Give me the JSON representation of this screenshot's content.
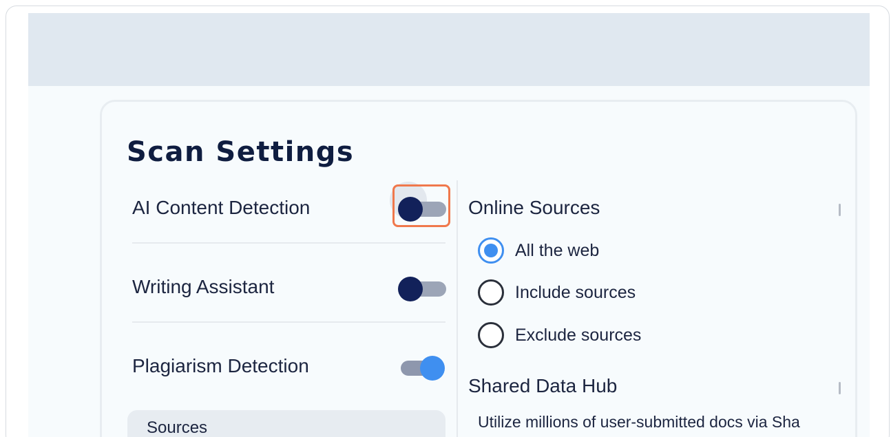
{
  "panel": {
    "title": "Scan Settings"
  },
  "toggles": [
    {
      "label": "AI Content Detection",
      "state": "off",
      "highlighted": true
    },
    {
      "label": "Writing Assistant",
      "state": "off",
      "highlighted": false
    },
    {
      "label": "Plagiarism Detection",
      "state": "on",
      "highlighted": false
    }
  ],
  "sources_box": {
    "label": "Sources"
  },
  "online_sources": {
    "title": "Online Sources",
    "options": [
      {
        "label": "All the web",
        "selected": true
      },
      {
        "label": "Include sources",
        "selected": false
      },
      {
        "label": "Exclude sources",
        "selected": false
      }
    ]
  },
  "shared_data_hub": {
    "title": "Shared Data Hub",
    "description": "Utilize millions of user-submitted docs via Sha"
  },
  "colors": {
    "accent": "#3f8ff0",
    "navy": "#12215a",
    "highlight": "#f0784c"
  }
}
